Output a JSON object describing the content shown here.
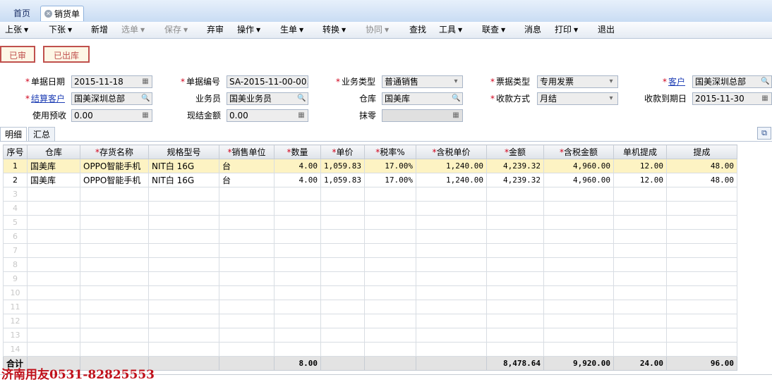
{
  "tabs": {
    "home": "首页",
    "sales": "销货单"
  },
  "toolbar": {
    "prev": "上张",
    "next": "下张",
    "new": "新增",
    "select": "选单",
    "save": "保存",
    "abandon": "弃审",
    "operate": "操作",
    "generate": "生单",
    "convert": "转换",
    "collab": "协同",
    "find": "查找",
    "tools": "工具",
    "link": "联查",
    "message": "消息",
    "print": "打印",
    "exit": "退出"
  },
  "status": {
    "approved": "已审",
    "shipped": "已出库"
  },
  "form": {
    "doc_date_label": "单据日期",
    "doc_date": "2015-11-18",
    "doc_no_label": "单据编号",
    "doc_no": "SA-2015-11-00-00...",
    "biz_type_label": "业务类型",
    "biz_type": "普通销售",
    "invoice_type_label": "票据类型",
    "invoice_type": "专用发票",
    "customer_label": "客户",
    "customer": "国美深圳总部",
    "settle_customer_label": "结算客户",
    "settle_customer": "国美深圳总部",
    "salesman_label": "业务员",
    "salesman": "国美业务员",
    "warehouse_label": "仓库",
    "warehouse": "国美库",
    "payment_method_label": "收款方式",
    "payment_method": "月结",
    "due_date_label": "收款到期日",
    "due_date": "2015-11-30",
    "prepay_label": "使用预收",
    "prepay": "0.00",
    "cash_label": "现结金额",
    "cash": "0.00",
    "rounding_label": "抹零",
    "rounding": ""
  },
  "subtabs": {
    "detail": "明细",
    "summary": "汇总"
  },
  "table": {
    "headers": [
      "序号",
      "仓库",
      "存货名称",
      "规格型号",
      "销售单位",
      "数量",
      "单价",
      "税率%",
      "含税单价",
      "金额",
      "含税金额",
      "单机提成",
      "提成"
    ],
    "rows": [
      [
        "1",
        "国美库",
        "OPPO智能手机",
        "NIT白 16G",
        "台",
        "4.00",
        "1,059.83",
        "17.00%",
        "1,240.00",
        "4,239.32",
        "4,960.00",
        "12.00",
        "48.00"
      ],
      [
        "2",
        "国美库",
        "OPPO智能手机",
        "NIT白 16G",
        "台",
        "4.00",
        "1,059.83",
        "17.00%",
        "1,240.00",
        "4,239.32",
        "4,960.00",
        "12.00",
        "48.00"
      ]
    ],
    "empty_rows": [
      "3",
      "4",
      "5",
      "6",
      "7",
      "8",
      "9",
      "10",
      "11",
      "12",
      "13",
      "14"
    ],
    "totals": {
      "label": "合计",
      "qty": "8.00",
      "amount": "8,478.64",
      "tax_amount": "9,920.00",
      "unit_commission": "24.00",
      "commission": "96.00"
    }
  },
  "watermark": "济南用友0531-82825553"
}
